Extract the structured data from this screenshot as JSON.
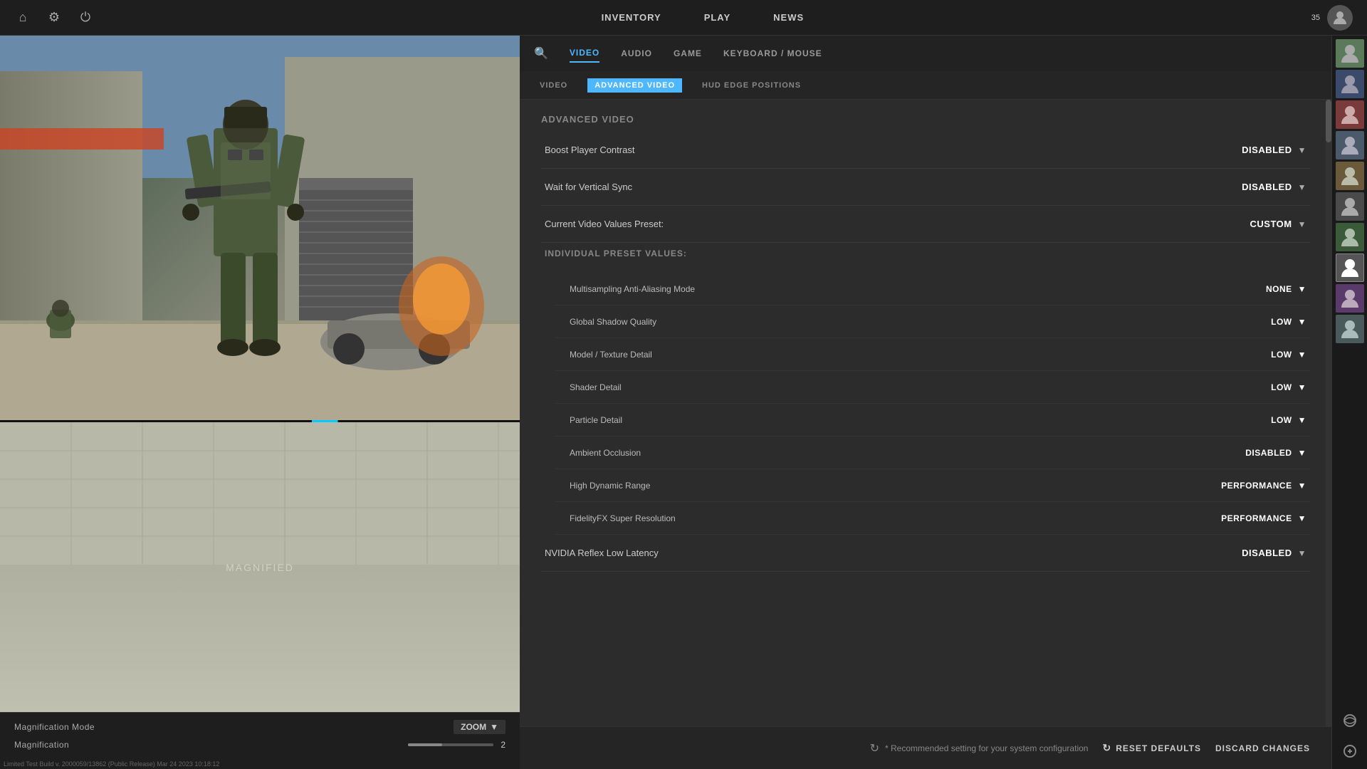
{
  "topBar": {
    "navLinks": [
      "INVENTORY",
      "PLAY",
      "NEWS"
    ],
    "userLevel": "35"
  },
  "tabs": {
    "main": [
      {
        "id": "video",
        "label": "VIDEO",
        "active": true
      },
      {
        "id": "audio",
        "label": "AUDIO",
        "active": false
      },
      {
        "id": "game",
        "label": "GAME",
        "active": false
      },
      {
        "id": "keyboard",
        "label": "KEYBOARD / MOUSE",
        "active": false
      }
    ],
    "sub": [
      {
        "id": "video-basic",
        "label": "VIDEO",
        "active": false
      },
      {
        "id": "advanced-video",
        "label": "ADVANCED VIDEO",
        "active": true
      },
      {
        "id": "hud",
        "label": "HUD EDGE POSITIONS",
        "active": false
      }
    ]
  },
  "advancedVideo": {
    "sectionTitle": "Advanced Video",
    "settings": [
      {
        "label": "Boost Player Contrast",
        "value": "DISABLED"
      },
      {
        "label": "Wait for Vertical Sync",
        "value": "DISABLED"
      },
      {
        "label": "Current Video Values Preset:",
        "value": "CUSTOM"
      }
    ],
    "presetLabel": "Individual Preset Values:",
    "presetSettings": [
      {
        "label": "Multisampling Anti-Aliasing Mode",
        "value": "NONE"
      },
      {
        "label": "Global Shadow Quality",
        "value": "LOW"
      },
      {
        "label": "Model / Texture Detail",
        "value": "LOW"
      },
      {
        "label": "Shader Detail",
        "value": "LOW"
      },
      {
        "label": "Particle Detail",
        "value": "LOW"
      },
      {
        "label": "Ambient Occlusion",
        "value": "DISABLED"
      },
      {
        "label": "High Dynamic Range",
        "value": "PERFORMANCE"
      },
      {
        "label": "FidelityFX Super Resolution",
        "value": "PERFORMANCE"
      }
    ],
    "nvidiaReflex": {
      "label": "NVIDIA Reflex Low Latency",
      "value": "DISABLED"
    }
  },
  "bottomBar": {
    "recommendation": "* Recommended setting for your system configuration",
    "resetButton": "RESET DEFAULTS",
    "discardButton": "DISCARD CHANGES"
  },
  "magnification": {
    "modeLabel": "Magnification Mode",
    "modeValue": "ZOOM",
    "magnificationLabel": "Magnification",
    "magnificationValue": "2"
  },
  "preview": {
    "magnifiedLabel": "Magnified"
  },
  "version": "Limited Test Build v. 2000059/13862 (Public Release) Mar 24 2023 10:18:12"
}
